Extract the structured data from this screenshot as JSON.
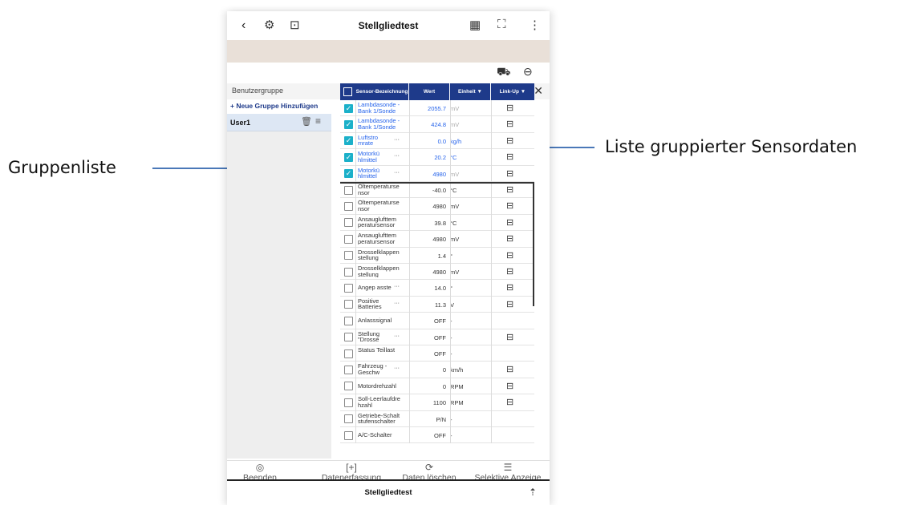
{
  "annotations": {
    "left_label": "Gruppenliste",
    "right_label": "Liste gruppierter Sensordaten"
  },
  "topbar": {
    "title": "Stellgliedtest",
    "icons": [
      "back-icon",
      "sensor-settings-icon",
      "export-icon",
      "calendar-camera-icon",
      "expand-icon",
      "more-vertical-icon"
    ]
  },
  "toolbar2": {
    "icons": [
      "vehicle-settings-icon",
      "gauge-icon"
    ]
  },
  "group_panel": {
    "header": "Benutzergruppe",
    "close": "✕",
    "add_group": "+ Neue Gruppe Hinzufügen",
    "groups": [
      {
        "name": "User1"
      }
    ]
  },
  "table": {
    "columns": [
      "Sensor-Bezeichnung",
      "Wert",
      "Einheit ▼",
      "Link-Up ▼"
    ],
    "rows": [
      {
        "name": "Lambdasonde -Bank 1/Sonde",
        "more": "",
        "wert": "2055.7",
        "unit": "mV",
        "link": true,
        "checked": true,
        "muted": true
      },
      {
        "name": "Lambdasonde -Bank 1/Sonde",
        "more": "",
        "wert": "424.8",
        "unit": "mV",
        "link": true,
        "checked": true,
        "muted": true
      },
      {
        "name": "Luftstro mrate",
        "more": "···",
        "wert": "0.0",
        "unit": "kg/h",
        "link": true,
        "checked": true,
        "muted": false
      },
      {
        "name": "Motorkü hlmittel",
        "more": "···",
        "wert": "20.2",
        "unit": "°C",
        "link": true,
        "checked": true,
        "muted": false
      },
      {
        "name": "Motorkü hlmittel",
        "more": "···",
        "wert": "4980",
        "unit": "mV",
        "link": true,
        "checked": true,
        "muted": true
      },
      {
        "name": "Öltemperaturse nsor",
        "more": "",
        "wert": "-40.0",
        "unit": "°C",
        "link": true,
        "checked": false,
        "muted": false
      },
      {
        "name": "Öltemperaturse nsor",
        "more": "",
        "wert": "4980",
        "unit": "mV",
        "link": true,
        "checked": false,
        "muted": false
      },
      {
        "name": "Ansauglufttem peratursensor",
        "more": "",
        "wert": "39.8",
        "unit": "°C",
        "link": true,
        "checked": false,
        "muted": false
      },
      {
        "name": "Ansauglufttem peratursensor",
        "more": "",
        "wert": "4980",
        "unit": "mV",
        "link": true,
        "checked": false,
        "muted": false
      },
      {
        "name": "Drosselklappen stellung",
        "more": "",
        "wert": "1.4",
        "unit": "°",
        "link": true,
        "checked": false,
        "muted": false
      },
      {
        "name": "Drosselklappen stellung",
        "more": "",
        "wert": "4980",
        "unit": "mV",
        "link": true,
        "checked": false,
        "muted": false
      },
      {
        "name": "Angep asste",
        "more": "···",
        "wert": "14.0",
        "unit": "°",
        "link": true,
        "checked": false,
        "muted": false
      },
      {
        "name": "Positive Batteries",
        "more": "···",
        "wert": "11.3",
        "unit": "V",
        "link": true,
        "checked": false,
        "muted": false
      },
      {
        "name": "Anlasssignal",
        "more": "",
        "wert": "OFF",
        "unit": "-",
        "link": false,
        "checked": false,
        "muted": false
      },
      {
        "name": "Stellung \"Drosse",
        "more": "···",
        "wert": "OFF",
        "unit": "-",
        "link": true,
        "checked": false,
        "muted": false
      },
      {
        "name": "Status Teillast",
        "more": "",
        "wert": "OFF",
        "unit": "-",
        "link": false,
        "checked": false,
        "muted": false
      },
      {
        "name": "Fahrzeug -Geschw",
        "more": "···",
        "wert": "0",
        "unit": "km/h",
        "link": true,
        "checked": false,
        "muted": false
      },
      {
        "name": "Motordrehzahl",
        "more": "",
        "wert": "0",
        "unit": "RPM",
        "link": true,
        "checked": false,
        "muted": false
      },
      {
        "name": "Soll-Leerlaufdre hzahl",
        "more": "",
        "wert": "1100",
        "unit": "RPM",
        "link": true,
        "checked": false,
        "muted": false
      },
      {
        "name": "Getriebe-Schalt stufenschalter",
        "more": "",
        "wert": "P/N",
        "unit": "-",
        "link": false,
        "checked": false,
        "muted": false
      },
      {
        "name": "A/C-Schalter",
        "more": "",
        "wert": "OFF",
        "unit": "-",
        "link": false,
        "checked": false,
        "muted": false
      }
    ]
  },
  "actions": [
    {
      "label": "Beenden",
      "icon": "◎"
    },
    {
      "label": "Datenerfassung",
      "icon": "[+]"
    },
    {
      "label": "Daten löschen",
      "icon": "⟳"
    },
    {
      "label": "Selektive Anzeige",
      "icon": "☰"
    }
  ],
  "footer": {
    "title": "Stellgliedtest"
  },
  "colors": {
    "accent": "#1e3a8a",
    "checkbox": "#1bb0c9",
    "annotation": "#4a78b8",
    "beige": "#e9e0d8"
  }
}
